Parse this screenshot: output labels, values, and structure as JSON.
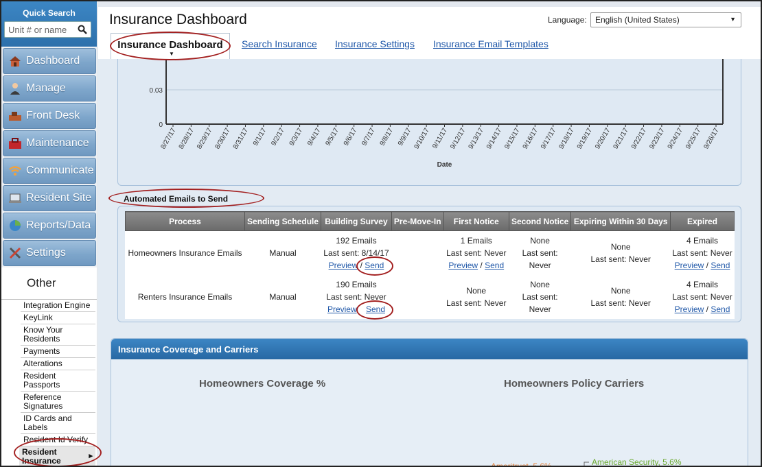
{
  "quick_search": {
    "title": "Quick Search",
    "placeholder": "Unit # or name"
  },
  "nav": [
    {
      "label": "Dashboard",
      "icon": "house-icon"
    },
    {
      "label": "Manage",
      "icon": "person-icon"
    },
    {
      "label": "Front Desk",
      "icon": "front-desk-icon"
    },
    {
      "label": "Maintenance",
      "icon": "toolbox-icon"
    },
    {
      "label": "Communicate",
      "icon": "wifi-icon"
    },
    {
      "label": "Resident Site",
      "icon": "laptop-icon"
    },
    {
      "label": "Reports/Data",
      "icon": "pie-chart-icon"
    },
    {
      "label": "Settings",
      "icon": "tools-icon"
    }
  ],
  "other": {
    "heading": "Other",
    "items": [
      "Integration Engine",
      "KeyLink",
      "Know Your Residents",
      "Payments",
      "Alterations",
      "Resident Passports",
      "Reference Signatures",
      "ID Cards and Labels",
      "Resident Id Verify",
      "Resident Insurance"
    ]
  },
  "header": {
    "title": "Insurance Dashboard",
    "language_label": "Language:",
    "language_value": "English (United States)",
    "tabs": [
      "Insurance Dashboard",
      "Search Insurance",
      "Insurance Settings",
      "Insurance Email Templates"
    ]
  },
  "chart_data": {
    "type": "line",
    "xlabel": "Date",
    "ylabel": "",
    "ylim": [
      0,
      0.06
    ],
    "y_ticks": [
      "0.03",
      "0"
    ],
    "x": [
      "8/27/17",
      "8/28/17",
      "8/29/17",
      "8/30/17",
      "8/31/17",
      "9/1/17",
      "9/2/17",
      "9/3/17",
      "9/4/17",
      "9/5/17",
      "9/6/17",
      "9/7/17",
      "9/8/17",
      "9/9/17",
      "9/10/17",
      "9/11/17",
      "9/12/17",
      "9/13/17",
      "9/14/17",
      "9/15/17",
      "9/16/17",
      "9/17/17",
      "9/18/17",
      "9/19/17",
      "9/20/17",
      "9/21/17",
      "9/22/17",
      "9/23/17",
      "9/24/17",
      "9/25/17",
      "9/26/17"
    ],
    "grid": true
  },
  "automated_emails": {
    "title": "Automated Emails to Send",
    "columns": [
      "Process",
      "Sending Schedule",
      "Building Survey",
      "Pre-Move-In",
      "First Notice",
      "Second Notice",
      "Expiring Within 30 Days",
      "Expired"
    ],
    "rows": [
      {
        "process": "Homeowners Insurance Emails",
        "schedule": "Manual",
        "building_survey": {
          "count": "192 Emails",
          "last": "Last sent: 8/14/17",
          "preview": "Preview",
          "send": "Send"
        },
        "pre_move_in": "",
        "first_notice": {
          "count": "1 Emails",
          "last": "Last sent: Never",
          "preview": "Preview",
          "send": "Send"
        },
        "second_notice": {
          "count": "None",
          "last": "Last sent: Never"
        },
        "expiring": {
          "count": "None",
          "last": "Last sent: Never"
        },
        "expired": {
          "count": "4 Emails",
          "last": "Last sent: Never",
          "preview": "Preview",
          "send": "Send"
        }
      },
      {
        "process": "Renters Insurance Emails",
        "schedule": "Manual",
        "building_survey": {
          "count": "190 Emails",
          "last": "Last sent: Never",
          "preview": "Preview",
          "send": "Send"
        },
        "pre_move_in": "",
        "first_notice": {
          "count": "None",
          "last": "Last sent: Never"
        },
        "second_notice": {
          "count": "None",
          "last": "Last sent: Never"
        },
        "expiring": {
          "count": "None",
          "last": "Last sent: Never"
        },
        "expired": {
          "count": "4 Emails",
          "last": "Last sent: Never",
          "preview": "Preview",
          "send": "Send"
        }
      }
    ]
  },
  "coverage": {
    "title": "Insurance Coverage and Carriers",
    "left_subtitle": "Homeowners Coverage %",
    "right_subtitle": "Homeowners Policy Carriers",
    "labels": [
      {
        "text": "Ameritrust, 5.6%",
        "color": "#e8823a"
      },
      {
        "text": "American Security, 5.6%",
        "color": "#6aa82e"
      }
    ]
  },
  "colors": {
    "accent": "#2d70ab",
    "link": "#1f57a8",
    "annotation": "#a32020"
  }
}
